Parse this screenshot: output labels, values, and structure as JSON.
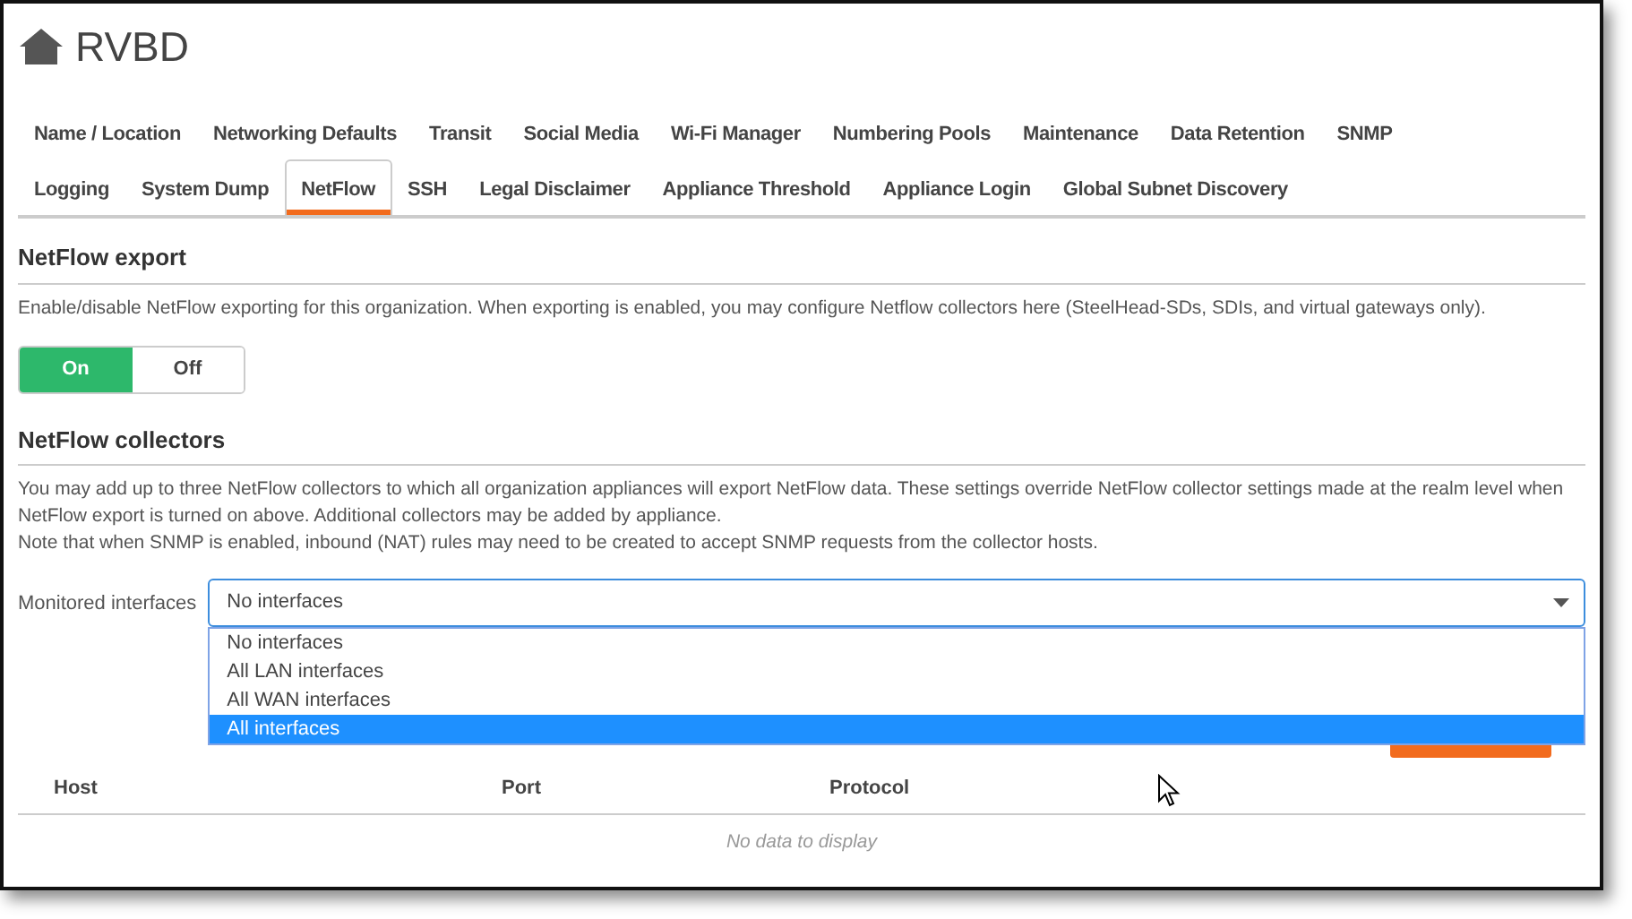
{
  "header": {
    "title": "RVBD"
  },
  "tab_rows": [
    [
      {
        "label": "Name / Location",
        "selected": false
      },
      {
        "label": "Networking Defaults",
        "selected": false
      },
      {
        "label": "Transit",
        "selected": false
      },
      {
        "label": "Social Media",
        "selected": false
      },
      {
        "label": "Wi-Fi Manager",
        "selected": false
      },
      {
        "label": "Numbering Pools",
        "selected": false
      },
      {
        "label": "Maintenance",
        "selected": false
      },
      {
        "label": "Data Retention",
        "selected": false
      },
      {
        "label": "SNMP",
        "selected": false
      }
    ],
    [
      {
        "label": "Logging",
        "selected": false
      },
      {
        "label": "System Dump",
        "selected": false
      },
      {
        "label": "NetFlow",
        "selected": true
      },
      {
        "label": "SSH",
        "selected": false
      },
      {
        "label": "Legal Disclaimer",
        "selected": false
      },
      {
        "label": "Appliance Threshold",
        "selected": false
      },
      {
        "label": "Appliance Login",
        "selected": false
      },
      {
        "label": "Global Subnet Discovery",
        "selected": false
      }
    ]
  ],
  "export": {
    "heading": "NetFlow export",
    "description": "Enable/disable NetFlow exporting for this organization. When exporting is enabled, you may configure Netflow collectors here (SteelHead-SDs, SDIs, and virtual gateways only).",
    "toggle": [
      {
        "label": "On",
        "selected": true
      },
      {
        "label": "Off",
        "selected": false
      }
    ]
  },
  "collectors": {
    "heading": "NetFlow collectors",
    "description": [
      "You may add up to three NetFlow collectors to which all organization appliances will export NetFlow data. These settings override NetFlow collector settings made at the realm level when NetFlow export is turned on above. Additional collectors may be added by appliance.",
      "Note that when SNMP is enabled, inbound (NAT) rules may need to be created to accept SNMP requests from the collector hosts."
    ],
    "monitored_interfaces": {
      "label": "Monitored interfaces",
      "value": "No interfaces",
      "expanded": true,
      "options": [
        {
          "label": "No interfaces",
          "highlighted": false
        },
        {
          "label": "All LAN interfaces",
          "highlighted": false
        },
        {
          "label": "All WAN interfaces",
          "highlighted": false
        },
        {
          "label": "All interfaces",
          "highlighted": true
        }
      ]
    },
    "table": {
      "columns": [
        "Host",
        "Port",
        "Protocol"
      ],
      "empty_message": "No data to display"
    }
  }
}
